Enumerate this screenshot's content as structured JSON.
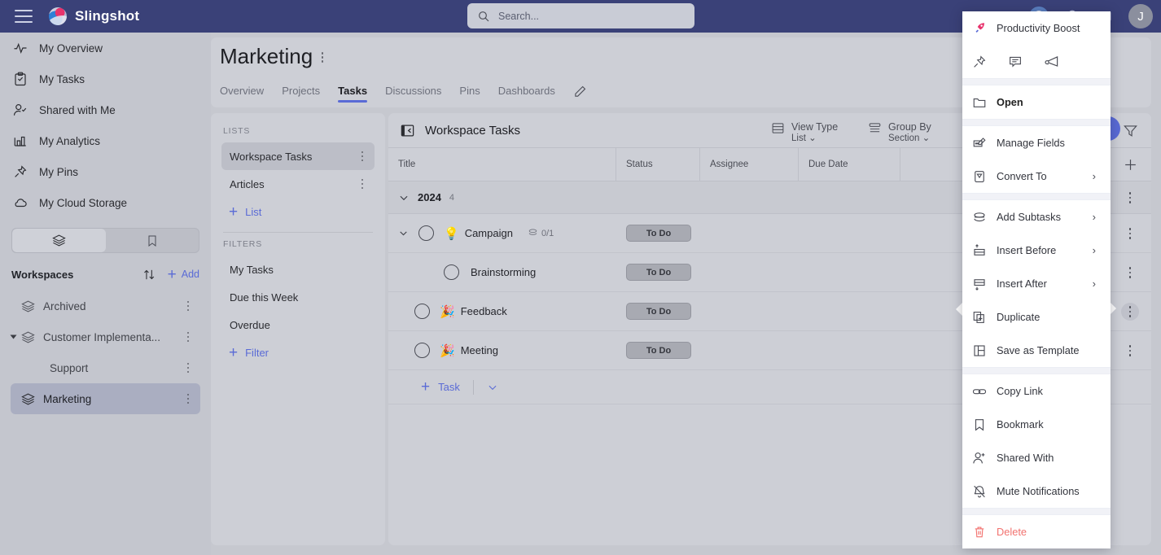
{
  "topbar": {
    "brand": "Slingshot",
    "menu_icon": "hamburger-icon",
    "search": {
      "placeholder": "Search...",
      "value": ""
    },
    "avatar_initial": "J"
  },
  "sidebar": {
    "nav": [
      {
        "label": "My Overview",
        "icon": "activity-icon"
      },
      {
        "label": "My Tasks",
        "icon": "clipboard-check-icon"
      },
      {
        "label": "Shared with Me",
        "icon": "user-check-icon"
      },
      {
        "label": "My Analytics",
        "icon": "bar-chart-icon"
      },
      {
        "label": "My Pins",
        "icon": "pin-icon"
      },
      {
        "label": "My Cloud Storage",
        "icon": "cloud-icon"
      }
    ],
    "segments": [
      {
        "icon": "layers-icon",
        "active": true
      },
      {
        "icon": "bookmark-icon",
        "active": false
      }
    ],
    "workspaces_label": "Workspaces",
    "sort_icon": "sort-arrows-icon",
    "add_label": "Add",
    "workspaces": [
      {
        "label": "Archived",
        "selected": false,
        "child": false,
        "expanded": false
      },
      {
        "label": "Customer Implementa...",
        "selected": false,
        "child": false,
        "expanded": true
      },
      {
        "label": "Support",
        "selected": false,
        "child": true,
        "expanded": false
      },
      {
        "label": "Marketing",
        "selected": true,
        "child": false,
        "expanded": false
      }
    ]
  },
  "header": {
    "title": "Marketing",
    "tabs": [
      {
        "label": "Overview",
        "active": false
      },
      {
        "label": "Projects",
        "active": false
      },
      {
        "label": "Tasks",
        "active": true
      },
      {
        "label": "Discussions",
        "active": false
      },
      {
        "label": "Pins",
        "active": false
      },
      {
        "label": "Dashboards",
        "active": false
      }
    ],
    "edit_icon": "pencil-icon"
  },
  "lists_panel": {
    "lists_label": "LISTS",
    "lists": [
      {
        "label": "Workspace Tasks",
        "selected": true
      },
      {
        "label": "Articles",
        "selected": false
      }
    ],
    "add_list_label": "List",
    "filters_label": "FILTERS",
    "filters": [
      {
        "label": "My Tasks"
      },
      {
        "label": "Due this Week"
      },
      {
        "label": "Overdue"
      }
    ],
    "add_filter_label": "Filter"
  },
  "tasks_panel": {
    "title": "Workspace Tasks",
    "collapse_icon": "panel-collapse-icon",
    "view_type": {
      "label": "View Type",
      "value": "List",
      "icon": "list-view-icon"
    },
    "group_by": {
      "label": "Group By",
      "value": "Section",
      "icon": "group-by-icon"
    },
    "columns": [
      "Title",
      "Status",
      "Assignee",
      "Due Date"
    ],
    "group": {
      "name": "2024",
      "count": "4"
    },
    "rows": [
      {
        "title": "Campaign",
        "emoji": "💡",
        "status": "To Do",
        "assignee": "",
        "due_date": "",
        "subtasks": "0/1",
        "indent": 0,
        "expandable": true
      },
      {
        "title": "Brainstorming",
        "emoji": "",
        "status": "To Do",
        "assignee": "",
        "due_date": "",
        "subtasks": "",
        "indent": 1,
        "expandable": false
      },
      {
        "title": "Feedback",
        "emoji": "🎉",
        "status": "To Do",
        "assignee": "",
        "due_date": "",
        "subtasks": "",
        "indent": 0,
        "expandable": false
      },
      {
        "title": "Meeting",
        "emoji": "🎉",
        "status": "To Do",
        "assignee": "",
        "due_date": "",
        "subtasks": "",
        "indent": 0,
        "expandable": false
      }
    ],
    "add_task_label": "Task"
  },
  "right_rail": {
    "filter_icon": "filter-icon",
    "add_icon": "plus-icon"
  },
  "context_menu": {
    "header": {
      "label": "Productivity Boost",
      "icon": "rocket-icon"
    },
    "quick_icons": [
      "pin-icon",
      "comment-icon",
      "announce-icon"
    ],
    "items": [
      {
        "label": "Open",
        "icon": "folder-icon",
        "bold": true,
        "chevron": false
      },
      {
        "label": "Manage Fields",
        "icon": "manage-fields-icon",
        "bold": false,
        "chevron": false
      },
      {
        "label": "Convert To",
        "icon": "convert-icon",
        "bold": false,
        "chevron": true
      },
      {
        "label": "Add Subtasks",
        "icon": "subtasks-icon",
        "bold": false,
        "chevron": true
      },
      {
        "label": "Insert Before",
        "icon": "insert-before-icon",
        "bold": false,
        "chevron": true
      },
      {
        "label": "Insert After",
        "icon": "insert-after-icon",
        "bold": false,
        "chevron": true
      },
      {
        "label": "Duplicate",
        "icon": "duplicate-icon",
        "bold": false,
        "chevron": false
      },
      {
        "label": "Save as Template",
        "icon": "template-icon",
        "bold": false,
        "chevron": false
      },
      {
        "label": "Copy Link",
        "icon": "link-icon",
        "bold": false,
        "chevron": false
      },
      {
        "label": "Bookmark",
        "icon": "bookmark-icon",
        "bold": false,
        "chevron": false
      },
      {
        "label": "Shared With",
        "icon": "user-plus-icon",
        "bold": false,
        "chevron": false
      },
      {
        "label": "Mute Notifications",
        "icon": "bell-off-icon",
        "bold": false,
        "chevron": false
      },
      {
        "label": "Delete",
        "icon": "trash-icon",
        "bold": false,
        "chevron": false,
        "danger": true
      }
    ]
  },
  "colors": {
    "topbar": "#3a4178",
    "accent": "#5a6bd6",
    "panel": "#cdcfd6",
    "sidebar": "#c4c6ce",
    "danger": "#f2726f",
    "badge": "#a8aab2"
  }
}
